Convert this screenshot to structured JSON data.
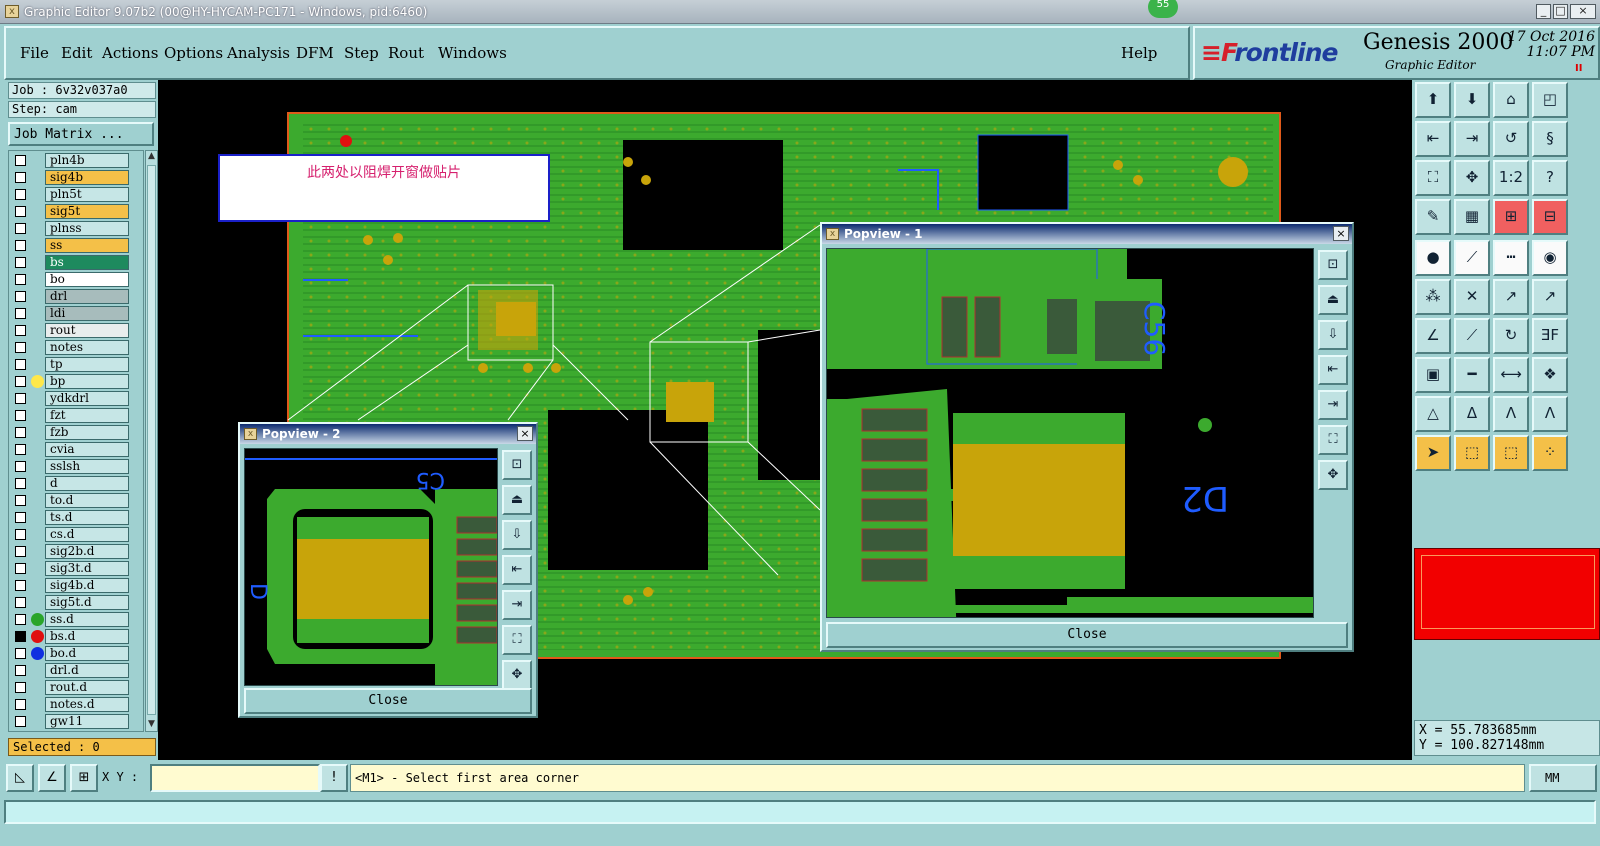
{
  "window": {
    "title": "Graphic Editor 9.07b2 (00@HY-HYCAM-PC171 - Windows, pid:6460)",
    "badge": "55",
    "controls": [
      "_",
      "□",
      "×"
    ]
  },
  "menu": {
    "items": [
      "File",
      "Edit",
      "Actions",
      "Options",
      "Analysis",
      "DFM",
      "Step",
      "Rout",
      "Windows"
    ],
    "help": "Help"
  },
  "brand": {
    "logo_prefix": "F",
    "logo_rest": "rontline",
    "product": "Genesis 2000",
    "subtitle": "Graphic Editor",
    "date": "17 Oct 2016",
    "time": "11:07 PM",
    "pause": "II"
  },
  "left": {
    "job": "Job : 6v32v037a0",
    "step": "Step: cam",
    "job_matrix": "Job Matrix ...",
    "selected": "Selected : 0"
  },
  "layers": [
    {
      "name": "pln4b",
      "style": "plain",
      "dot": ""
    },
    {
      "name": "sig4b",
      "style": "sig",
      "dot": ""
    },
    {
      "name": "pln5t",
      "style": "plain",
      "dot": ""
    },
    {
      "name": "sig5t",
      "style": "sig",
      "dot": ""
    },
    {
      "name": "plnss",
      "style": "plain",
      "dot": ""
    },
    {
      "name": "ss",
      "style": "sig",
      "dot": ""
    },
    {
      "name": "bs",
      "style": "bs",
      "dot": ""
    },
    {
      "name": "bo",
      "style": "bo",
      "dot": ""
    },
    {
      "name": "drl",
      "style": "drl",
      "dot": ""
    },
    {
      "name": "ldi",
      "style": "drl",
      "dot": ""
    },
    {
      "name": "rout",
      "style": "rout",
      "dot": ""
    },
    {
      "name": "notes",
      "style": "plain",
      "dot": ""
    },
    {
      "name": "tp",
      "style": "plain",
      "dot": ""
    },
    {
      "name": "bp",
      "style": "plain",
      "dot": "#ffe84a"
    },
    {
      "name": "ydkdrl",
      "style": "plain",
      "dot": ""
    },
    {
      "name": "fzt",
      "style": "plain",
      "dot": ""
    },
    {
      "name": "fzb",
      "style": "plain",
      "dot": ""
    },
    {
      "name": "cvia",
      "style": "plain",
      "dot": ""
    },
    {
      "name": "sslsh",
      "style": "plain",
      "dot": ""
    },
    {
      "name": "d",
      "style": "plain",
      "dot": ""
    },
    {
      "name": "to.d",
      "style": "plain",
      "dot": ""
    },
    {
      "name": "ts.d",
      "style": "plain",
      "dot": ""
    },
    {
      "name": "cs.d",
      "style": "plain",
      "dot": ""
    },
    {
      "name": "sig2b.d",
      "style": "plain",
      "dot": ""
    },
    {
      "name": "sig3t.d",
      "style": "plain",
      "dot": ""
    },
    {
      "name": "sig4b.d",
      "style": "plain",
      "dot": ""
    },
    {
      "name": "sig5t.d",
      "style": "plain",
      "dot": ""
    },
    {
      "name": "ss.d",
      "style": "plain",
      "dot": "#2aa52a"
    },
    {
      "name": "bs.d",
      "style": "plain",
      "dot": "#e01010"
    },
    {
      "name": "bo.d",
      "style": "plain",
      "dot": "#1030e0"
    },
    {
      "name": "drl.d",
      "style": "plain",
      "dot": ""
    },
    {
      "name": "rout.d",
      "style": "plain",
      "dot": ""
    },
    {
      "name": "notes.d",
      "style": "plain",
      "dot": ""
    },
    {
      "name": "gw11",
      "style": "plain",
      "dot": ""
    }
  ],
  "canvas": {
    "note": "此两处以阻焊开窗做贴片"
  },
  "popview1": {
    "title": "Popview - 1",
    "close": "Close"
  },
  "popview2": {
    "title": "Popview - 2",
    "close": "Close"
  },
  "coords": {
    "x": "X =  55.783685mm",
    "y": "Y = 100.827148mm"
  },
  "bottom": {
    "xy_label": "X Y :",
    "xy_value": "",
    "prompt": "<M1> - Select first area corner",
    "units": "MM",
    "bang": "!"
  },
  "colors": {
    "board_green": "#3caa2e",
    "pad_gold": "#c8a40a",
    "trace_blue": "#1f5cff",
    "panel_teal": "#9fd0d0",
    "layer_orange": "#f4c048"
  }
}
